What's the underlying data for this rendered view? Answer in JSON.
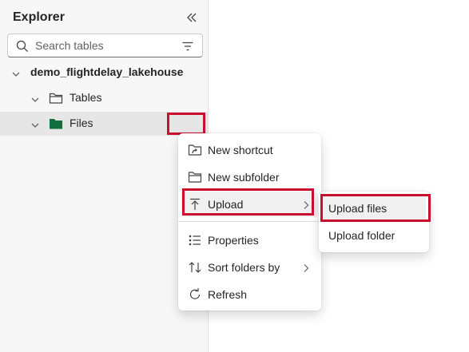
{
  "explorer": {
    "title": "Explorer",
    "search": {
      "placeholder": "Search tables"
    },
    "tree": {
      "lakehouse": "demo_flightdelay_lakehouse",
      "tables": "Tables",
      "files": "Files"
    }
  },
  "context_menu": {
    "items": [
      {
        "label": "New shortcut",
        "icon": "shortcut-folder-icon"
      },
      {
        "label": "New subfolder",
        "icon": "folder-icon"
      },
      {
        "label": "Upload",
        "icon": "upload-icon",
        "has_submenu": true
      },
      {
        "label": "Properties",
        "icon": "properties-icon"
      },
      {
        "label": "Sort folders by",
        "icon": "sort-icon",
        "has_submenu": true
      },
      {
        "label": "Refresh",
        "icon": "refresh-icon"
      }
    ]
  },
  "upload_submenu": {
    "items": [
      {
        "label": "Upload files"
      },
      {
        "label": "Upload folder"
      }
    ]
  },
  "colors": {
    "highlight_border": "#c8102e",
    "files_folder": "#0f6f3f",
    "selected_row": "#e6e6e6"
  }
}
